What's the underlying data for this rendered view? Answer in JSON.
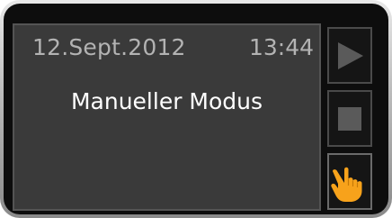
{
  "display": {
    "date": "12.Sept.2012",
    "time": "13:44",
    "mode": "Manueller Modus"
  },
  "buttons": [
    {
      "name": "play",
      "icon": "play-icon"
    },
    {
      "name": "stop",
      "icon": "stop-icon"
    },
    {
      "name": "manual",
      "icon": "hand-pointer-icon"
    }
  ],
  "colors": {
    "screen": "#3a3a3a",
    "text_dim": "#b3b3b3",
    "text_bright": "#ffffff",
    "icon_gray": "#5a5a5a",
    "hand_orange": "#f7a21b"
  }
}
